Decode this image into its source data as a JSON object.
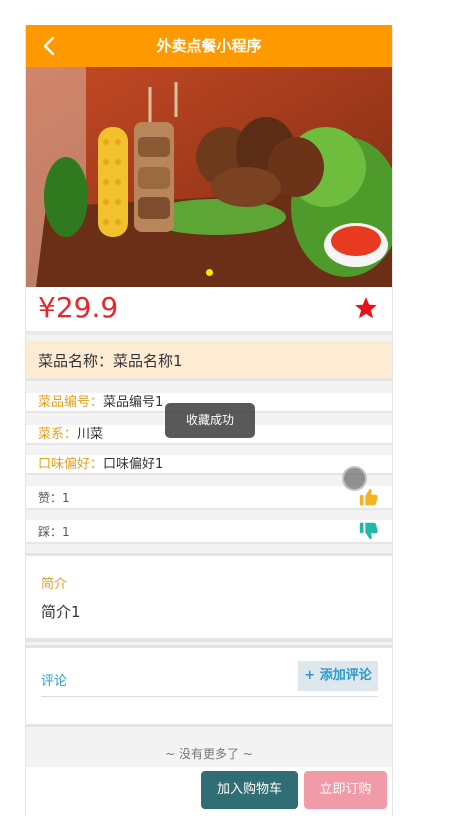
{
  "nav": {
    "title": "外卖点餐小程序",
    "back_icon": "chevron-left-icon"
  },
  "hero": {
    "image": "grilled-skewers-and-corn-photo",
    "dot_color": "#ffee00"
  },
  "price": "¥29.9",
  "favorite_icon": "star-icon",
  "dish": {
    "name_label": "菜品名称：",
    "name_value": "菜品名称1",
    "fields": [
      {
        "label": "菜品编号：",
        "value": "菜品编号1"
      },
      {
        "label": "菜系：",
        "value": "川菜"
      },
      {
        "label": "口味偏好：",
        "value": "口味偏好1"
      }
    ],
    "likes": {
      "label": "赞：",
      "value": "1",
      "icon": "thumbs-up-icon"
    },
    "dislikes": {
      "label": "踩：",
      "value": "1",
      "icon": "thumbs-down-icon"
    }
  },
  "toast": "收藏成功",
  "intro": {
    "label": "简介",
    "text": "简介1"
  },
  "comments": {
    "label": "评论",
    "add_button": "+ 添加评论"
  },
  "no_more": "~ 没有更多了 ~",
  "bottom": {
    "cart_button": "加入购物车",
    "order_button": "立即订购"
  },
  "colors": {
    "nav": "#ff9900",
    "price": "#e8262c",
    "accent_label": "#e0a020",
    "cart": "#2f6e72",
    "order": "#f19aa8",
    "comment": "#2aa0d0"
  }
}
